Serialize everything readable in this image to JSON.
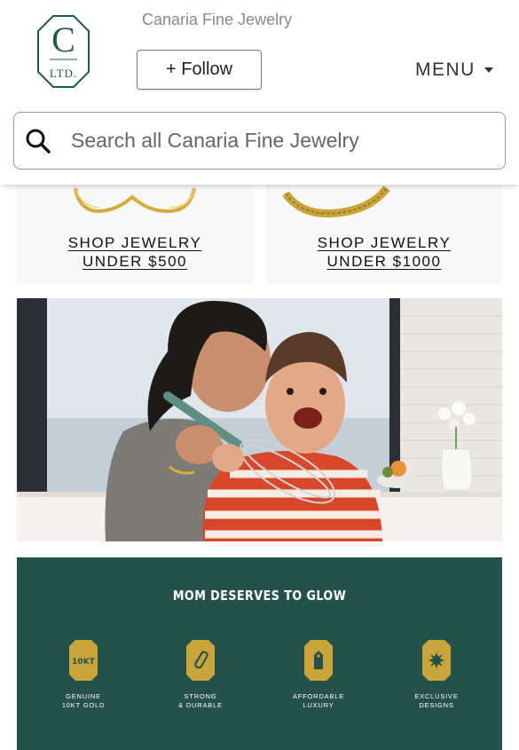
{
  "header": {
    "brand_name": "Canaria Fine Jewelry",
    "logo_letter": "C",
    "logo_sub": "LTD.",
    "follow_label": "+ Follow",
    "menu_label": "MENU"
  },
  "search": {
    "placeholder": "Search all Canaria Fine Jewelry"
  },
  "shop_tiles": [
    {
      "line1": "SHOP JEWELRY",
      "line2": "UNDER $500"
    },
    {
      "line1": "SHOP JEWELRY",
      "line2": "UNDER $1000"
    }
  ],
  "promo": {
    "title": "MOM DESERVES TO GLOW",
    "features": [
      {
        "icon": "10kt-badge-icon",
        "icon_text": "10KT",
        "label": "GENUINE\n10KT GOLD"
      },
      {
        "icon": "paperclip-icon",
        "label": "STRONG\n& DURABLE"
      },
      {
        "icon": "price-tag-icon",
        "label": "AFFORDABLE\nLUXURY"
      },
      {
        "icon": "starburst-icon",
        "label": "EXCLUSIVE\nDESIGNS"
      }
    ]
  },
  "colors": {
    "brand_green": "#1f5a4f",
    "promo_bg": "#24524b",
    "gold": "#c9a43a"
  }
}
